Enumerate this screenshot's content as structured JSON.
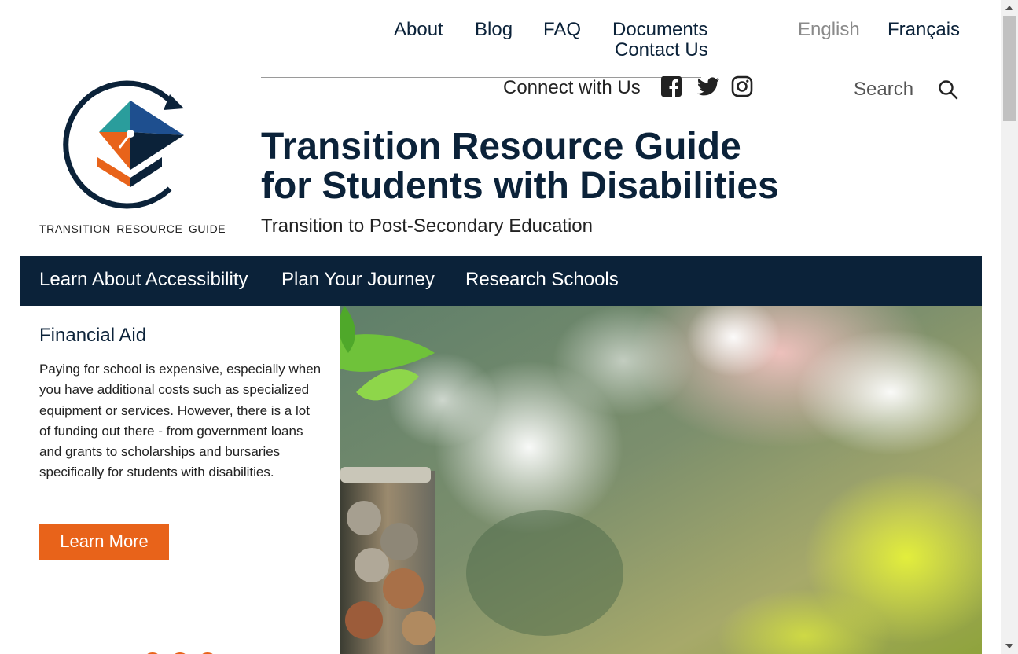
{
  "top_nav": {
    "items": [
      "About",
      "Blog",
      "FAQ",
      "Documents",
      "Contact Us"
    ],
    "lang_english": "English",
    "lang_french": "Français"
  },
  "social": {
    "label": "Connect with Us",
    "icons": [
      "facebook-icon",
      "twitter-icon",
      "instagram-icon"
    ]
  },
  "search": {
    "label": "Search"
  },
  "logo": {
    "text": "TRANSITION RESOURCE GUIDE"
  },
  "header": {
    "title_line1": "Transition Resource Guide",
    "title_line2": "for Students with Disabilities",
    "subtitle": "Transition to Post-Secondary Education"
  },
  "main_nav": {
    "items": [
      "Learn About Accessibility",
      "Plan Your Journey",
      "Research Schools"
    ]
  },
  "feature": {
    "title": "Financial Aid",
    "body": "Paying for school is expensive, especially when you have additional costs such as specialized equipment or services. However, there is a lot of funding out there - from government loans and grants to scholarships and bursaries specifically for students with disabilities.",
    "button": "Learn More"
  },
  "colors": {
    "navy": "#0b2239",
    "orange": "#e8631a",
    "teal": "#2a9d9c",
    "blue": "#1e4f8f",
    "muted_link": "#8a8a8a"
  }
}
